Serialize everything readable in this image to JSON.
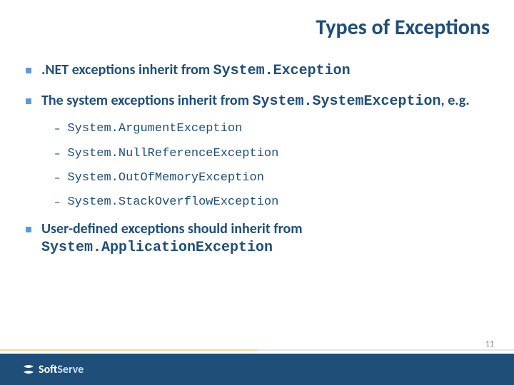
{
  "title": "Types of Exceptions",
  "bullets": [
    {
      "pre": ".NET exceptions inherit from ",
      "code": "System.Exception",
      "post": ""
    },
    {
      "pre": "The system exceptions inherit from ",
      "code": "System.SystemException",
      "post": ", e.g."
    },
    {
      "pre": "User-defined exceptions should inherit from ",
      "code": "System.ApplicationException",
      "post": ""
    }
  ],
  "sub_items": [
    "System.ArgumentException",
    "System.NullReferenceException",
    "System.OutOfMemoryException",
    "System.StackOverflowException"
  ],
  "logo": {
    "part1": "Soft",
    "part2": "Serve"
  },
  "page_number": "11"
}
